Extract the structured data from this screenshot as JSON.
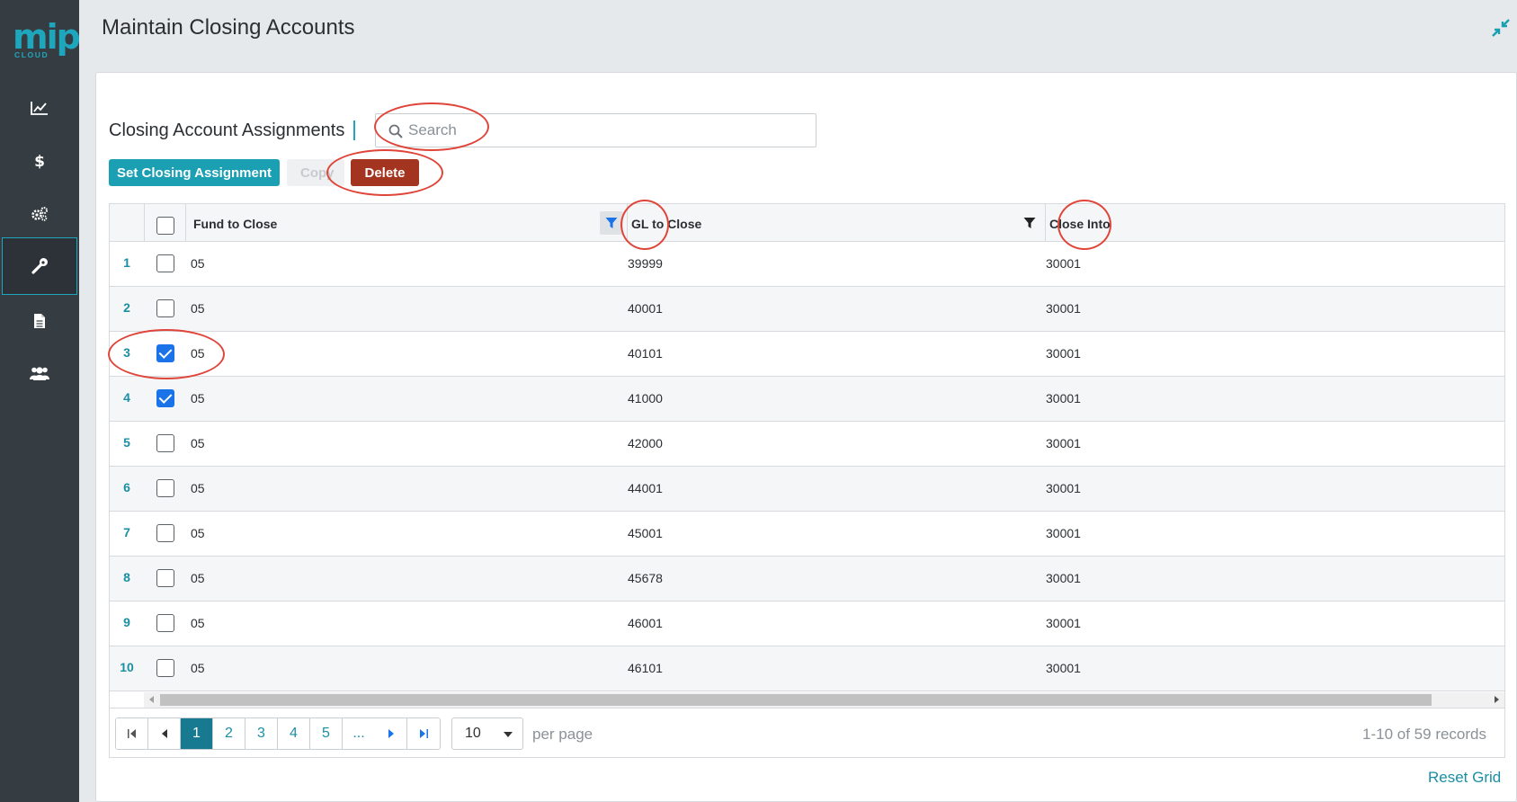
{
  "sidebar": {
    "logo_text": "mip",
    "logo_subtext": "CLOUD",
    "items": [
      {
        "icon": "chart-line-icon"
      },
      {
        "icon": "dollar-icon"
      },
      {
        "icon": "gears-icon"
      },
      {
        "icon": "wrench-icon",
        "active": true
      },
      {
        "icon": "document-icon"
      },
      {
        "icon": "users-icon"
      }
    ]
  },
  "header": {
    "title": "Maintain Closing Accounts",
    "collapse_icon": "compress-icon"
  },
  "section": {
    "title": "Closing Account Assignments"
  },
  "search": {
    "placeholder": "Search",
    "value": ""
  },
  "toolbar": {
    "set_label": "Set Closing Assignment",
    "copy_label": "Copy",
    "delete_label": "Delete"
  },
  "grid": {
    "columns": {
      "fund": "Fund to Close",
      "gl": "GL to Close",
      "close_into": "Close Into"
    },
    "rows": [
      {
        "num": "1",
        "checked": false,
        "fund": "05",
        "gl": "39999",
        "close_into": "30001"
      },
      {
        "num": "2",
        "checked": false,
        "fund": "05",
        "gl": "40001",
        "close_into": "30001"
      },
      {
        "num": "3",
        "checked": true,
        "fund": "05",
        "gl": "40101",
        "close_into": "30001"
      },
      {
        "num": "4",
        "checked": true,
        "fund": "05",
        "gl": "41000",
        "close_into": "30001"
      },
      {
        "num": "5",
        "checked": false,
        "fund": "05",
        "gl": "42000",
        "close_into": "30001"
      },
      {
        "num": "6",
        "checked": false,
        "fund": "05",
        "gl": "44001",
        "close_into": "30001"
      },
      {
        "num": "7",
        "checked": false,
        "fund": "05",
        "gl": "45001",
        "close_into": "30001"
      },
      {
        "num": "8",
        "checked": false,
        "fund": "05",
        "gl": "45678",
        "close_into": "30001"
      },
      {
        "num": "9",
        "checked": false,
        "fund": "05",
        "gl": "46001",
        "close_into": "30001"
      },
      {
        "num": "10",
        "checked": false,
        "fund": "05",
        "gl": "46101",
        "close_into": "30001"
      }
    ]
  },
  "pager": {
    "pages": [
      "1",
      "2",
      "3",
      "4",
      "5",
      "..."
    ],
    "current": "1",
    "per_page": "10",
    "per_page_label": "per page",
    "records": "1-10 of 59 records"
  },
  "reset_label": "Reset Grid",
  "colors": {
    "accent": "#1a9fb3",
    "danger": "#a3341f",
    "sidebar": "#363d42",
    "annotation": "#e0453a"
  }
}
